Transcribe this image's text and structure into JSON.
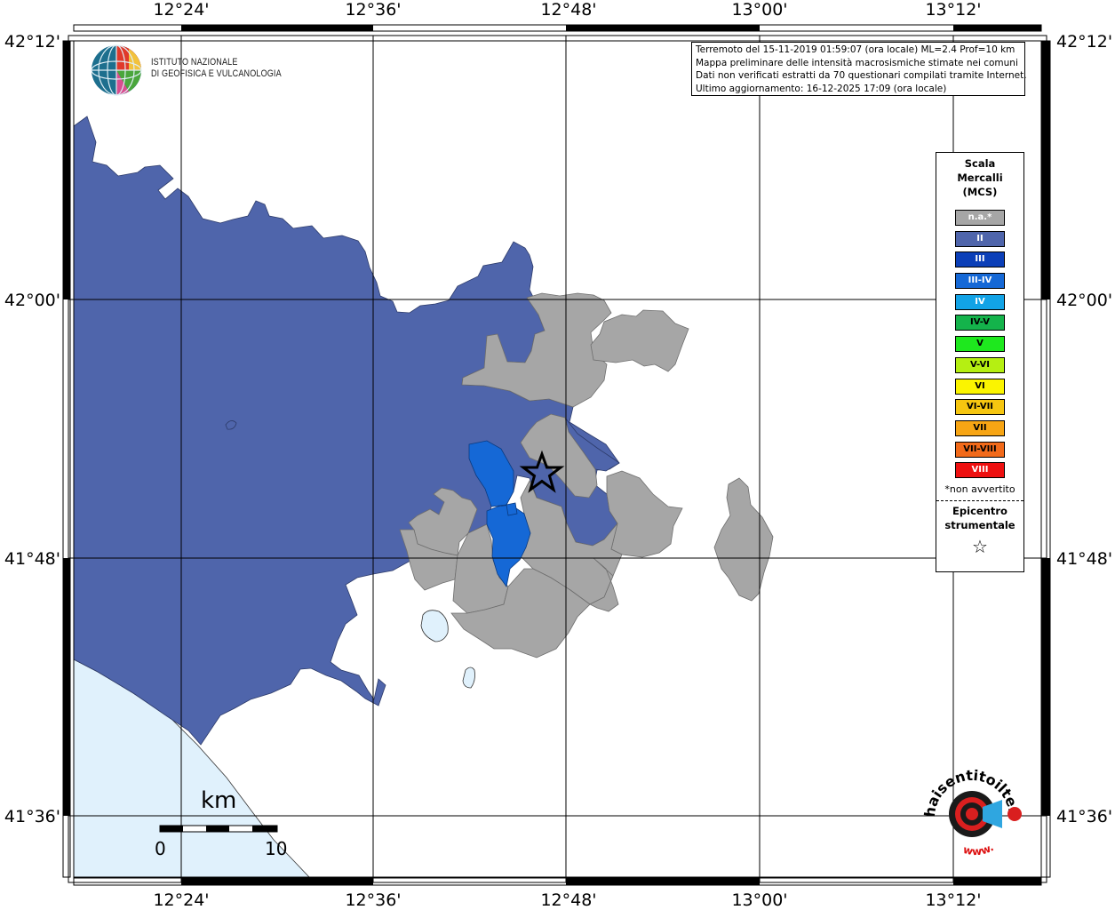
{
  "info": {
    "line1": "Terremoto del 15-11-2019 01:59:07 (ora locale) ML=2.4 Prof=10 km",
    "line2": "Mappa preliminare delle intensità macrosismiche stimate nei comuni",
    "line3": "Dati non verificati estratti da 70 questionari compilati tramite Internet.",
    "line4": "Ultimo aggiornamento: 16-12-2025 17:09 (ora locale)"
  },
  "institute": {
    "line1": "ISTITUTO NAZIONALE",
    "line2": "DI GEOFISICA E VULCANOLOGIA"
  },
  "axes": {
    "top_labels": [
      "12°24'",
      "12°36'",
      "12°48'",
      "13°00'",
      "13°12'"
    ],
    "bottom_labels": [
      "12°24'",
      "12°36'",
      "12°48'",
      "13°00'",
      "13°12'"
    ],
    "left_labels": [
      "42°12'",
      "42°00'",
      "41°48'",
      "41°36'"
    ],
    "right_labels": [
      "42°12'",
      "42°00'",
      "41°48'",
      "41°36'"
    ]
  },
  "legend": {
    "title1": "Scala",
    "title2": "Mercalli",
    "title3": "(MCS)",
    "items": [
      {
        "label": "n.a.*",
        "color": "#a6a6a6",
        "text": "#ffffff"
      },
      {
        "label": "II",
        "color": "#4f65ab",
        "text": "#ffffff"
      },
      {
        "label": "III",
        "color": "#0b3fb8",
        "text": "#ffffff"
      },
      {
        "label": "III-IV",
        "color": "#1568d6",
        "text": "#ffffff"
      },
      {
        "label": "IV",
        "color": "#12a3e6",
        "text": "#ffffff"
      },
      {
        "label": "IV-V",
        "color": "#14b34b",
        "text": "#000000"
      },
      {
        "label": "V",
        "color": "#1ee81e",
        "text": "#000000"
      },
      {
        "label": "V-VI",
        "color": "#b5ef12",
        "text": "#000000"
      },
      {
        "label": "VI",
        "color": "#fbf400",
        "text": "#000000"
      },
      {
        "label": "VI-VII",
        "color": "#f6c610",
        "text": "#000000"
      },
      {
        "label": "VII",
        "color": "#f7a514",
        "text": "#000000"
      },
      {
        "label": "VII-VIII",
        "color": "#f26a1a",
        "text": "#000000"
      },
      {
        "label": "VIII",
        "color": "#ee1010",
        "text": "#ffffff"
      }
    ],
    "note": "*non avvertito",
    "epicenter1": "Epicentro",
    "epicenter2": "strumentale",
    "epicenter_symbol": "☆"
  },
  "scale": {
    "unit": "km",
    "min": "0",
    "max": "10"
  },
  "logo_hst": {
    "text": "haisentitoilterremoto.it",
    "sub": "www."
  },
  "colors": {
    "sea": "#e0f1fc",
    "lake": "#e0f1fc",
    "intensity_ii": "#4f65ab",
    "intensity_iii_iv": "#1568d6",
    "not_felt": "#a6a6a6"
  }
}
